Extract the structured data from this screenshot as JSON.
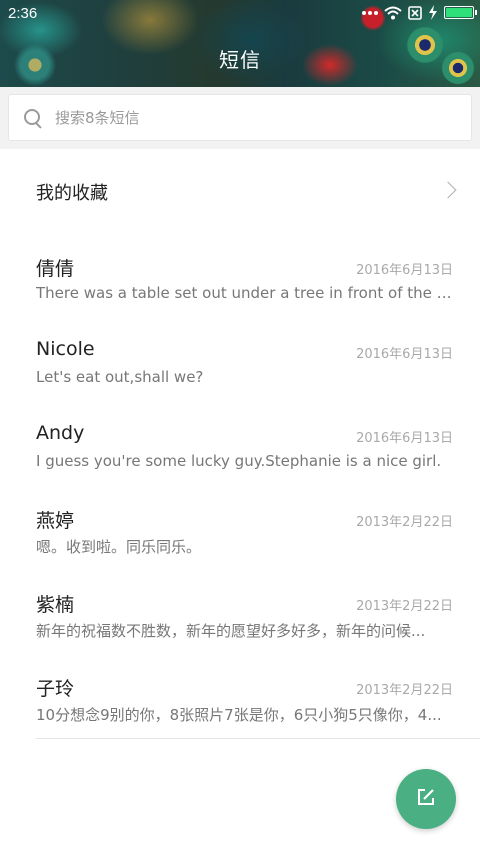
{
  "status_bar": {
    "time": "2:36",
    "icons": [
      "more-icon",
      "wifi-icon",
      "sim-icon",
      "charging-icon",
      "battery-icon"
    ],
    "battery_color": "#2fe07a"
  },
  "header": {
    "title": "短信"
  },
  "search": {
    "placeholder": "搜索8条短信"
  },
  "favorites": {
    "label": "我的收藏"
  },
  "messages": [
    {
      "name": "倩倩",
      "date": "2016年6月13日",
      "preview": "There was a table set out under a tree in front of the ho..."
    },
    {
      "name": "Nicole",
      "date": "2016年6月13日",
      "preview": "Let's eat out,shall we?"
    },
    {
      "name": "Andy",
      "date": "2016年6月13日",
      "preview": "I guess you're some lucky guy.Stephanie is a nice girl."
    },
    {
      "name": "燕婷",
      "date": "2013年2月22日",
      "preview": "嗯。收到啦。同乐同乐。"
    },
    {
      "name": "紫楠",
      "date": "2013年2月22日",
      "preview": "新年的祝福数不胜数，新年的愿望好多好多，新年的问候..."
    },
    {
      "name": "子玲",
      "date": "2013年2月22日",
      "preview": "10分想念9别的你，8张照片7张是你，6只小狗5只像你，4..."
    }
  ],
  "fab": {
    "icon": "compose-icon",
    "color": "#4aaf83"
  }
}
